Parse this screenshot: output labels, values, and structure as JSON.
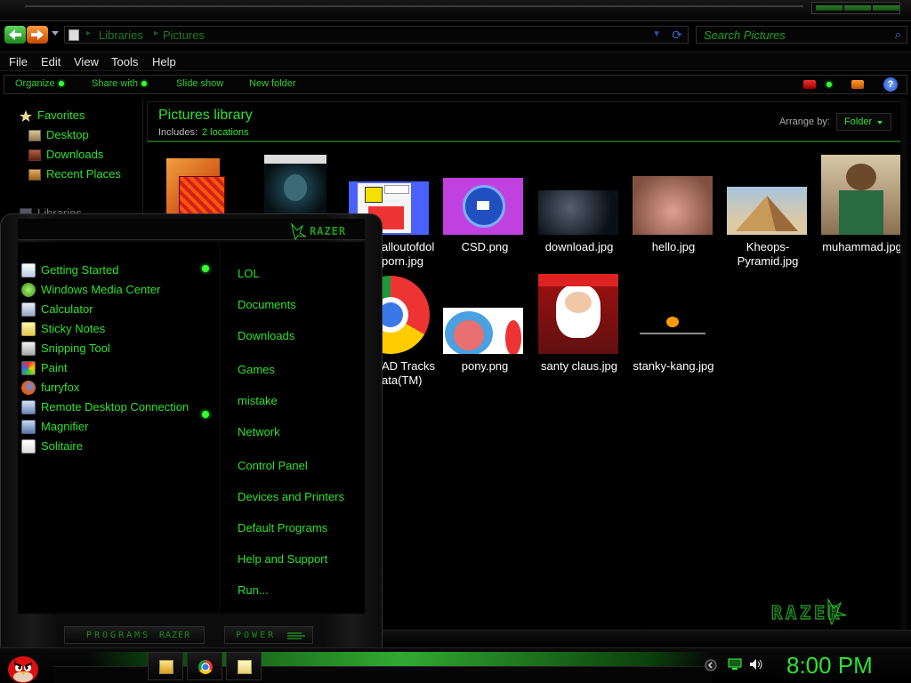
{
  "window": {
    "address": {
      "crumbs": [
        "Libraries",
        "Pictures"
      ]
    },
    "search": {
      "placeholder": "Search Pictures"
    },
    "menu": [
      "File",
      "Edit",
      "View",
      "Tools",
      "Help"
    ],
    "commands": [
      "Organize",
      "Share with",
      "Slide show",
      "New folder"
    ],
    "nav": {
      "favorites": "Favorites",
      "items": [
        "Desktop",
        "Downloads",
        "Recent Places"
      ],
      "libraries": "Libraries"
    },
    "library": {
      "title": "Pictures library",
      "includes_label": "Includes:",
      "locations": "2 locations",
      "arrange_label": "Arrange by:",
      "arrange_value": "Folder"
    },
    "files": [
      {
        "name": "",
        "thumb": "orange-folder"
      },
      {
        "name": "",
        "thumb": "movie-poster"
      },
      {
        "name": "alloutofdol porn.jpg",
        "thumb": "cartoon"
      },
      {
        "name": "CSD.png",
        "thumb": "badge"
      },
      {
        "name": "download.jpg",
        "thumb": "portrait-dark"
      },
      {
        "name": "hello.jpg",
        "thumb": "blur-pink"
      },
      {
        "name": "Kheops-Pyramid.jpg",
        "thumb": "pyramid"
      },
      {
        "name": "muhammad.jpg",
        "thumb": "painting"
      },
      {
        "name": "AD Tracks ata(TM)",
        "thumb": "chrome"
      },
      {
        "name": "pony.png",
        "thumb": "pony"
      },
      {
        "name": "santy claus.jpg",
        "thumb": "santa"
      },
      {
        "name": "stanky-kang.jpg",
        "thumb": "game-screen"
      }
    ]
  },
  "startmenu": {
    "brand": "RAZER",
    "programs": [
      {
        "label": "Getting Started",
        "icon": "document-icon",
        "submenu": true
      },
      {
        "label": "Windows Media Center",
        "icon": "media-center-icon",
        "submenu": false
      },
      {
        "label": "Calculator",
        "icon": "calculator-icon",
        "submenu": false
      },
      {
        "label": "Sticky Notes",
        "icon": "sticky-notes-icon",
        "submenu": false
      },
      {
        "label": "Snipping Tool",
        "icon": "scissors-icon",
        "submenu": false
      },
      {
        "label": "Paint",
        "icon": "paint-icon",
        "submenu": false
      },
      {
        "label": "furryfox",
        "icon": "firefox-icon",
        "submenu": true
      },
      {
        "label": "Remote Desktop Connection",
        "icon": "remote-desktop-icon",
        "submenu": false
      },
      {
        "label": "Magnifier",
        "icon": "magnifier-icon",
        "submenu": false
      },
      {
        "label": "Solitaire",
        "icon": "cards-icon",
        "submenu": false
      }
    ],
    "places": [
      "LOL",
      "Documents",
      "Downloads",
      "Games",
      "mistake",
      "Network",
      "Control Panel",
      "Devices and Printers",
      "Default Programs",
      "Help and Support",
      "Run..."
    ],
    "programs_button": "PROGRAMS",
    "power_button": "POWER"
  },
  "taskbar": {
    "pinned": [
      "explorer-icon",
      "chrome-icon",
      "notepad-icon"
    ],
    "clock": "8:00 PM"
  },
  "colors": {
    "accent": "#2fe02f",
    "background": "#000000"
  }
}
